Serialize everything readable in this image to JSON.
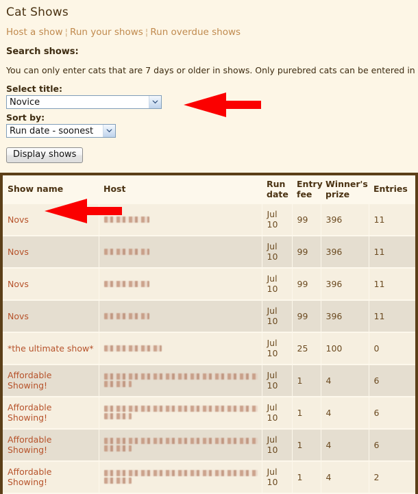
{
  "page": {
    "title": "Cat Shows",
    "background_color": "#fdf6e6",
    "accent_color": "#b6522a",
    "border_color": "#5b3f18"
  },
  "nav": {
    "separator": "¦",
    "links": [
      {
        "label": "Host a show"
      },
      {
        "label": "Run your shows"
      },
      {
        "label": "Run overdue shows"
      }
    ]
  },
  "search": {
    "heading": "Search shows:",
    "notice": "You can only enter cats that are 7 days or older in shows. Only purebred cats can be entered in shows."
  },
  "form": {
    "title_label": "Select title:",
    "title_value": "Novice",
    "sort_label": "Sort by:",
    "sort_value": "Run date - soonest",
    "submit_label": "Display shows"
  },
  "table": {
    "headers": [
      {
        "label": "Show name"
      },
      {
        "label": "Host"
      },
      {
        "label": "Run date"
      },
      {
        "label": "Entry fee"
      },
      {
        "label": "Winner's prize"
      },
      {
        "label": "Entries"
      }
    ],
    "rows": [
      {
        "show_name": "Novs",
        "host": "",
        "host_lines": 1,
        "run_date": "Jul 10",
        "entry_fee": "99",
        "winners_prize": "396",
        "entries": "11"
      },
      {
        "show_name": "Novs",
        "host": "",
        "host_lines": 1,
        "run_date": "Jul 10",
        "entry_fee": "99",
        "winners_prize": "396",
        "entries": "11"
      },
      {
        "show_name": "Novs",
        "host": "",
        "host_lines": 1,
        "run_date": "Jul 10",
        "entry_fee": "99",
        "winners_prize": "396",
        "entries": "11"
      },
      {
        "show_name": "Novs",
        "host": "",
        "host_lines": 1,
        "run_date": "Jul 10",
        "entry_fee": "99",
        "winners_prize": "396",
        "entries": "11"
      },
      {
        "show_name": "*the ultimate show*",
        "host": "",
        "host_lines": 1,
        "run_date": "Jul 10",
        "entry_fee": "25",
        "winners_prize": "100",
        "entries": "0"
      },
      {
        "show_name": "Affordable Showing!",
        "host": "",
        "host_lines": 2,
        "run_date": "Jul 10",
        "entry_fee": "1",
        "winners_prize": "4",
        "entries": "6"
      },
      {
        "show_name": "Affordable Showing!",
        "host": "",
        "host_lines": 2,
        "run_date": "Jul 10",
        "entry_fee": "1",
        "winners_prize": "4",
        "entries": "6"
      },
      {
        "show_name": "Affordable Showing!",
        "host": "",
        "host_lines": 2,
        "run_date": "Jul 10",
        "entry_fee": "1",
        "winners_prize": "4",
        "entries": "6"
      },
      {
        "show_name": "Affordable Showing!",
        "host": "",
        "host_lines": 2,
        "run_date": "Jul 10",
        "entry_fee": "1",
        "winners_prize": "4",
        "entries": "2"
      }
    ]
  },
  "annotations": {
    "color": "#fb0000",
    "arrows": [
      {
        "name": "arrow-pointing-to-title-select",
        "direction": "left"
      },
      {
        "name": "arrow-pointing-to-first-show-row",
        "direction": "left"
      }
    ]
  }
}
